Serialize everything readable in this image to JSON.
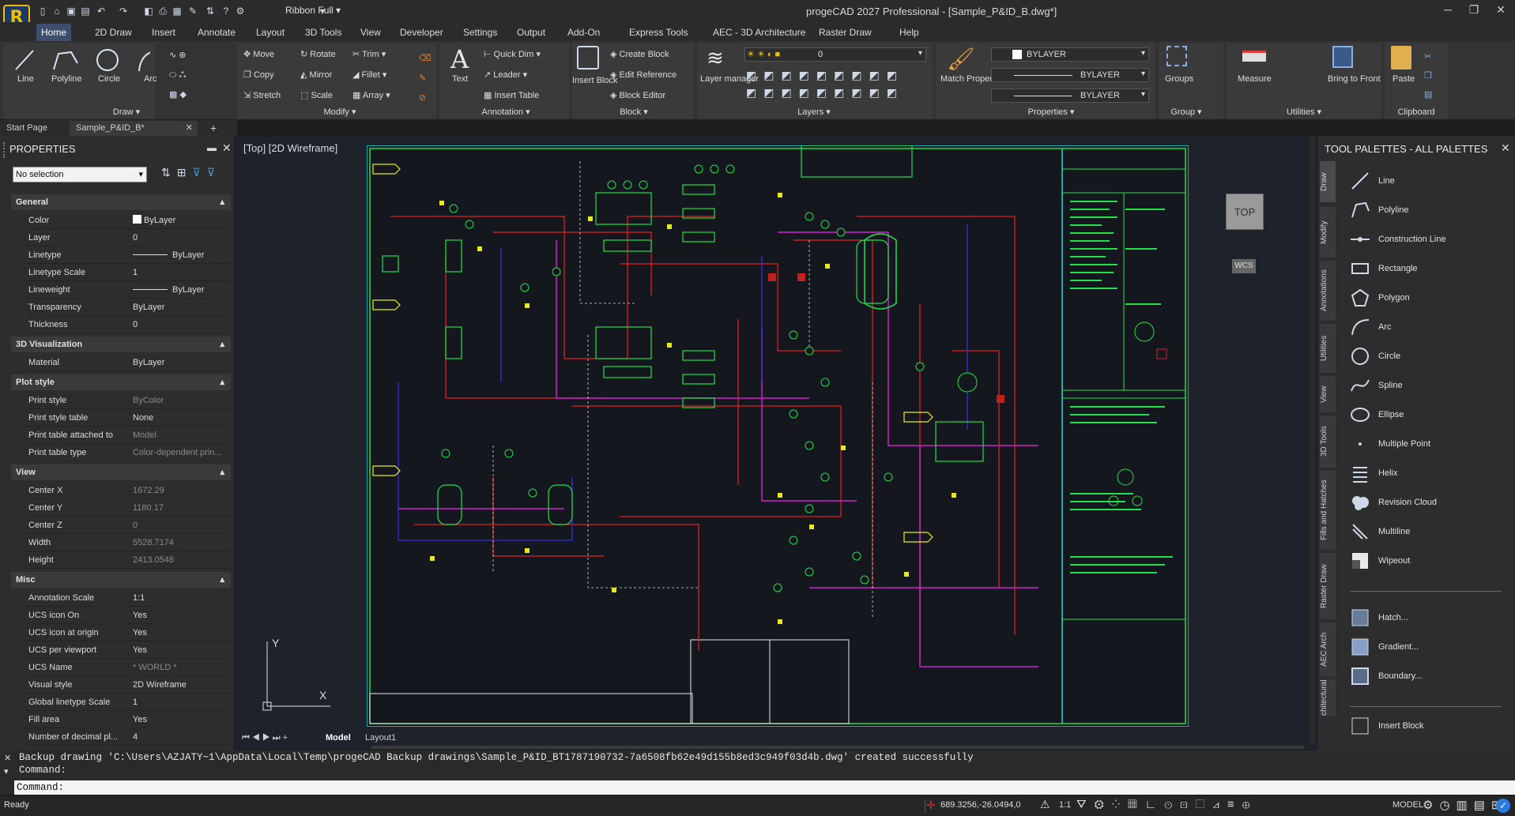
{
  "title_bar": {
    "app_logo_letter": "R",
    "ribbon_mode": "Ribbon Full",
    "window_title": "progeCAD 2027 Professional - [Sample_P&ID_B.dwg*]"
  },
  "menu_tabs": [
    "Home",
    "2D Draw",
    "Insert",
    "Annotate",
    "Layout",
    "3D Tools",
    "View",
    "Developer",
    "Settings",
    "Output",
    "Add-On",
    "Express Tools",
    "AEC - 3D Architecture",
    "Raster Draw",
    "Help"
  ],
  "ribbon": {
    "draw": {
      "title": "Draw",
      "line": "Line",
      "polyline": "Polyline",
      "circle": "Circle",
      "arc": "Arc"
    },
    "modify": {
      "title": "Modify",
      "move": "Move",
      "rotate": "Rotate",
      "trim": "Trim",
      "copy": "Copy",
      "mirror": "Mirror",
      "fillet": "Fillet",
      "stretch": "Stretch",
      "scale": "Scale",
      "array": "Array"
    },
    "annotation": {
      "title": "Annotation",
      "text": "Text",
      "quick_dim": "Quick Dim",
      "leader": "Leader",
      "insert_table": "Insert Table"
    },
    "block": {
      "title": "Block",
      "insert_block": "Insert Block",
      "create_block": "Create Block",
      "edit_reference": "Edit Reference",
      "block_editor": "Block Editor"
    },
    "layers": {
      "title": "Layers",
      "layer_manager": "Layer manager",
      "current_layer": "0"
    },
    "properties": {
      "title": "Properties",
      "match": "Match Properties",
      "color": "BYLAYER",
      "linetype": "BYLAYER",
      "lineweight": "BYLAYER"
    },
    "group": {
      "title": "Group",
      "groups": "Groups"
    },
    "utilities": {
      "title": "Utilities",
      "measure": "Measure",
      "bring_to_front": "Bring to Front"
    },
    "clipboard": {
      "title": "Clipboard",
      "paste": "Paste"
    }
  },
  "doc_tabs": {
    "start": "Start Page",
    "active": "Sample_P&ID_B*"
  },
  "properties": {
    "title": "PROPERTIES",
    "selection": "No selection",
    "sections": [
      {
        "name": "General",
        "rows": [
          {
            "k": "Color",
            "v": "ByLayer"
          },
          {
            "k": "Layer",
            "v": "0"
          },
          {
            "k": "Linetype",
            "v": "ByLayer"
          },
          {
            "k": "Linetype Scale",
            "v": "1"
          },
          {
            "k": "Lineweight",
            "v": "ByLayer"
          },
          {
            "k": "Transparency",
            "v": "ByLayer"
          },
          {
            "k": "Thickness",
            "v": "0"
          }
        ]
      },
      {
        "name": "3D Visualization",
        "rows": [
          {
            "k": "Material",
            "v": "ByLayer"
          }
        ]
      },
      {
        "name": "Plot style",
        "rows": [
          {
            "k": "Print style",
            "v": "ByColor"
          },
          {
            "k": "Print style table",
            "v": "None"
          },
          {
            "k": "Print table attached to",
            "v": "Model"
          },
          {
            "k": "Print table type",
            "v": "Color-dependent prin..."
          }
        ]
      },
      {
        "name": "View",
        "rows": [
          {
            "k": "Center X",
            "v": "1672.29"
          },
          {
            "k": "Center Y",
            "v": "1180.17"
          },
          {
            "k": "Center Z",
            "v": "0"
          },
          {
            "k": "Width",
            "v": "5528.7174"
          },
          {
            "k": "Height",
            "v": "2413.0548"
          }
        ]
      },
      {
        "name": "Misc",
        "rows": [
          {
            "k": "Annotation Scale",
            "v": "1:1"
          },
          {
            "k": "UCS icon On",
            "v": "Yes"
          },
          {
            "k": "UCS icon at origin",
            "v": "Yes"
          },
          {
            "k": "UCS per viewport",
            "v": "Yes"
          },
          {
            "k": "UCS Name",
            "v": "* WORLD *"
          },
          {
            "k": "Visual style",
            "v": "2D Wireframe"
          },
          {
            "k": "Global linetype Scale",
            "v": "1"
          },
          {
            "k": "Fill area",
            "v": "Yes"
          },
          {
            "k": "Number of decimal pl...",
            "v": "4"
          }
        ]
      }
    ]
  },
  "viewport": {
    "label": "[Top]  [2D Wireframe]",
    "cube_label": "TOP",
    "wcs_label": "WCS",
    "ucs_x": "X",
    "ucs_y": "Y"
  },
  "layout_tabs": {
    "model": "Model",
    "layout1": "Layout1"
  },
  "tool_palettes": {
    "title": "TOOL PALETTES - ALL PALETTES",
    "side_tabs": [
      "Draw",
      "Modify",
      "Annotations",
      "Utilities",
      "View",
      "3D Tools",
      "Fills and Hatches",
      "Raster Draw",
      "AEC Arch",
      "chitectural"
    ],
    "items": [
      "Line",
      "Polyline",
      "Construction Line",
      "Rectangle",
      "Polygon",
      "Arc",
      "Circle",
      "Spline",
      "Ellipse",
      "Multiple Point",
      "Helix",
      "Revision Cloud",
      "Multiline",
      "Wipeout",
      "Hatch...",
      "Gradient...",
      "Boundary...",
      "Insert Block"
    ]
  },
  "command": {
    "history_1": "Backup drawing 'C:\\Users\\AZJATY~1\\AppData\\Local\\Temp\\progeCAD Backup drawings\\Sample_P&ID_BT1787190732-7a6508fb62e49d155b8ed3c949f03d4b.dwg' created successfully",
    "history_2": "Command:",
    "prompt": "Command:"
  },
  "status": {
    "ready": "Ready",
    "coords": "689.3256,-26.0494,0",
    "scale": "1:1",
    "model": "MODEL"
  },
  "colors": {
    "accent": "#3c4f6e",
    "bg": "#1e1e1e",
    "drawing_green": "#22e04a",
    "drawing_red": "#e02020",
    "drawing_magenta": "#d020d0",
    "drawing_yellow": "#e8e820",
    "drawing_cyan": "#20e0e0",
    "drawing_blue": "#3030e0"
  }
}
